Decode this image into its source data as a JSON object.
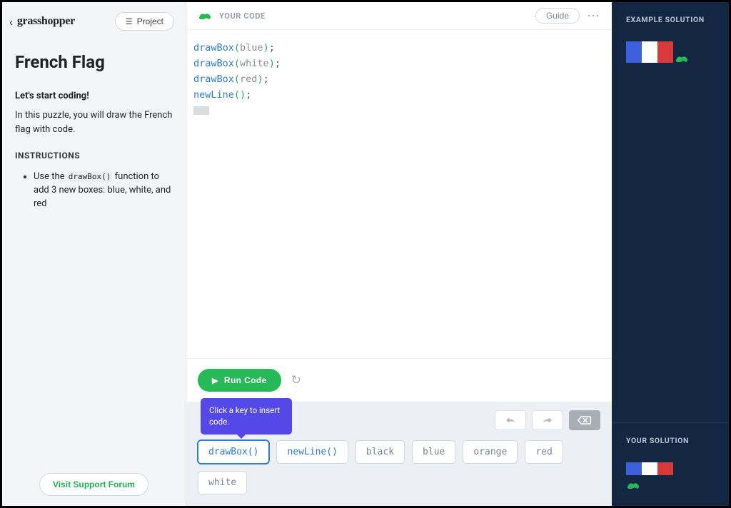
{
  "brand": "grasshopper",
  "project_button": "Project",
  "puzzle_title": "French Flag",
  "lets_start": "Let's start coding!",
  "intro": "In this puzzle, you will draw the French flag with code.",
  "instructions_label": "INSTRUCTIONS",
  "instruction_pre": "Use the ",
  "instruction_code": "drawBox()",
  "instruction_post": " function to add 3 new boxes: blue, white, and red",
  "support_button": "Visit Support Forum",
  "your_code_label": "YOUR CODE",
  "guide_button": "Guide",
  "code": {
    "l1_fn": "drawBox",
    "l1_var": "blue",
    "l2_fn": "drawBox",
    "l2_var": "white",
    "l3_fn": "drawBox",
    "l3_var": "red",
    "l4_fn": "newLine"
  },
  "run_button": "Run Code",
  "tooltip": "Click a key to insert code.",
  "keys": {
    "drawbox": "drawBox()",
    "newline": "newLine()",
    "black": "black",
    "blue": "blue",
    "orange": "orange",
    "red": "red",
    "white": "white"
  },
  "example_label": "EXAMPLE SOLUTION",
  "your_solution_label": "YOUR SOLUTION",
  "colors": {
    "accent_green": "#27b857",
    "accent_blue": "#2e7bd6",
    "tooltip_purple": "#5448e8",
    "flag_blue": "#3b5fdd",
    "flag_white": "#ffffff",
    "flag_red": "#d63b3b"
  }
}
